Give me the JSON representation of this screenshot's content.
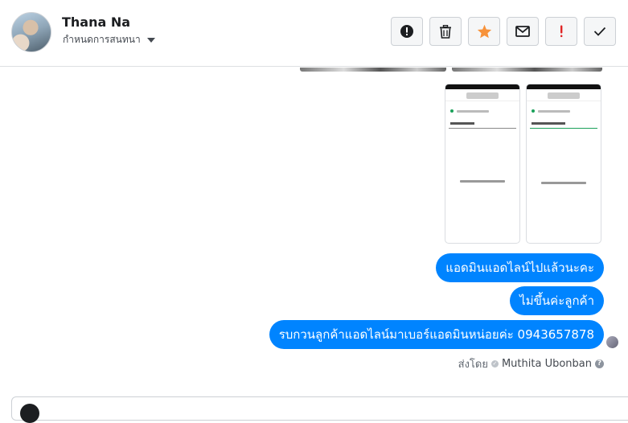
{
  "header": {
    "contact_name": "Thana Na",
    "subtitle": "กำหนดการสนทนา",
    "actions": [
      {
        "name": "mark-spam-button",
        "icon": "alert-circle-icon"
      },
      {
        "name": "delete-button",
        "icon": "trash-icon"
      },
      {
        "name": "star-button",
        "icon": "star-icon"
      },
      {
        "name": "mark-unread-button",
        "icon": "envelope-icon"
      },
      {
        "name": "follow-up-button",
        "icon": "exclamation-icon"
      },
      {
        "name": "mark-done-button",
        "icon": "check-icon"
      }
    ]
  },
  "messages": [
    {
      "text": "แอดมินแอดไลน์ไปแล้วนะคะ"
    },
    {
      "text": "ไม่ขึ้นค่ะลูกค้า"
    },
    {
      "text": "รบกวนลูกค้าแอดไลน์มาเบอร์แอดมินหน่อยค่ะ 0943657878"
    }
  ],
  "sent_by": {
    "label": "ส่งโดย",
    "name": "Muthita Ubonban"
  },
  "colors": {
    "bubble": "#0084ff",
    "star": "#f7923a",
    "flag": "#e02424"
  }
}
